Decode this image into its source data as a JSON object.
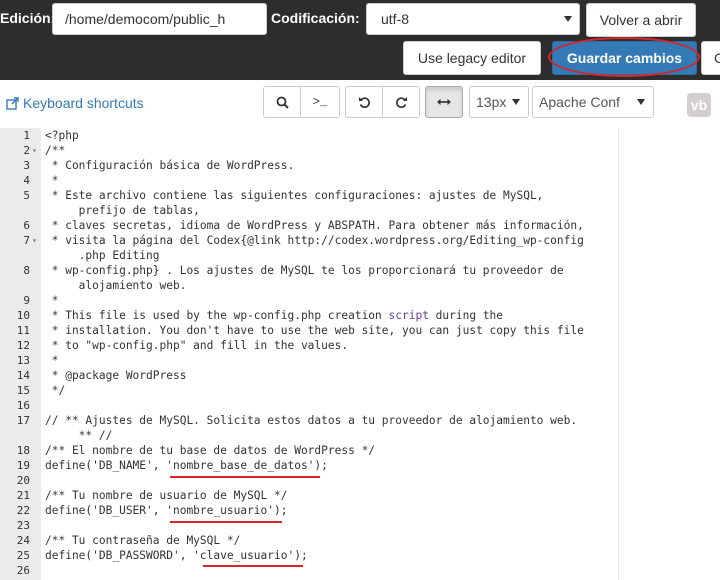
{
  "topbar": {
    "path_label": "Edición:",
    "path_value": "/home/democom/public_h",
    "encoding_label": "Codificación:",
    "encoding_value": "utf-8",
    "reopen_button": "Volver a abrir",
    "legacy_button": "Use legacy editor",
    "save_button": "Guardar cambios",
    "close_button": "C"
  },
  "toolbar": {
    "keyboard_shortcuts": "Keyboard shortcuts",
    "terminal_glyph": ">_",
    "font_size": "13px",
    "mode": "Apache Conf",
    "logo": "vb"
  },
  "editor": {
    "lines": [
      {
        "n": "1",
        "fold": "",
        "segs": [
          {
            "t": "<?php",
            "k": "c"
          }
        ]
      },
      {
        "n": "2",
        "fold": "▾",
        "segs": [
          {
            "t": "/**",
            "k": "c"
          }
        ]
      },
      {
        "n": "3",
        "fold": "",
        "segs": [
          {
            "t": " * Configuración básica de WordPress.",
            "k": "c"
          }
        ]
      },
      {
        "n": "4",
        "fold": "",
        "segs": [
          {
            "t": " *",
            "k": "c"
          }
        ]
      },
      {
        "n": "5",
        "fold": "",
        "segs": [
          {
            "t": " * Este archivo contiene las siguientes configuraciones: ajustes de MySQL,",
            "k": "c"
          }
        ]
      },
      {
        "n": "",
        "fold": "",
        "segs": [
          {
            "t": "     prefijo de tablas,",
            "k": "c"
          }
        ]
      },
      {
        "n": "6",
        "fold": "",
        "segs": [
          {
            "t": " * claves secretas, idioma de WordPress y ABSPATH. Para obtener más información,",
            "k": "c"
          }
        ]
      },
      {
        "n": "7",
        "fold": "▾",
        "segs": [
          {
            "t": " * visita la página del Codex{@link http://codex.wordpress.org/Editing_wp-config",
            "k": "c"
          }
        ]
      },
      {
        "n": "",
        "fold": "",
        "segs": [
          {
            "t": "     .php Editing",
            "k": "c"
          }
        ]
      },
      {
        "n": "8",
        "fold": "",
        "segs": [
          {
            "t": " * wp-config.php} . Los ajustes de MySQL te los proporcionará tu proveedor de",
            "k": "c"
          }
        ]
      },
      {
        "n": "",
        "fold": "",
        "segs": [
          {
            "t": "     alojamiento web.",
            "k": "c"
          }
        ]
      },
      {
        "n": "9",
        "fold": "",
        "segs": [
          {
            "t": " *",
            "k": "c"
          }
        ]
      },
      {
        "n": "10",
        "fold": "",
        "segs": [
          {
            "t": " * This file is used by the wp-config.php creation ",
            "k": "c"
          },
          {
            "t": "script",
            "k": "kw"
          },
          {
            "t": " during the",
            "k": "c"
          }
        ]
      },
      {
        "n": "11",
        "fold": "",
        "segs": [
          {
            "t": " * installation. You don't have to use the web site, you can just copy this file",
            "k": "c"
          }
        ]
      },
      {
        "n": "12",
        "fold": "",
        "segs": [
          {
            "t": " * to \"wp-config.php\" and fill in the values.",
            "k": "c"
          }
        ]
      },
      {
        "n": "13",
        "fold": "",
        "segs": [
          {
            "t": " *",
            "k": "c"
          }
        ]
      },
      {
        "n": "14",
        "fold": "",
        "segs": [
          {
            "t": " * @package WordPress",
            "k": "c"
          }
        ]
      },
      {
        "n": "15",
        "fold": "",
        "segs": [
          {
            "t": " */",
            "k": "c"
          }
        ]
      },
      {
        "n": "16",
        "fold": "",
        "segs": [
          {
            "t": "",
            "k": "c"
          }
        ]
      },
      {
        "n": "17",
        "fold": "",
        "segs": [
          {
            "t": "// ** Ajustes de MySQL. Solicita estos datos a tu proveedor de alojamiento web.",
            "k": "c"
          }
        ]
      },
      {
        "n": "",
        "fold": "",
        "segs": [
          {
            "t": "     ** //",
            "k": "c"
          }
        ]
      },
      {
        "n": "18",
        "fold": "",
        "segs": [
          {
            "t": "/** El nombre de tu base de datos de WordPress */",
            "k": "c"
          }
        ]
      },
      {
        "n": "19",
        "fold": "",
        "segs": [
          {
            "t": "define('DB_NAME', 'nombre_base_de_datos');",
            "k": "c"
          }
        ]
      },
      {
        "n": "20",
        "fold": "",
        "segs": [
          {
            "t": "",
            "k": "c"
          }
        ]
      },
      {
        "n": "21",
        "fold": "",
        "segs": [
          {
            "t": "/** Tu nombre de usuario de MySQL */",
            "k": "c"
          }
        ]
      },
      {
        "n": "22",
        "fold": "",
        "segs": [
          {
            "t": "define('DB_USER', 'nombre_usuario');",
            "k": "c"
          }
        ]
      },
      {
        "n": "23",
        "fold": "",
        "segs": [
          {
            "t": "",
            "k": "c"
          }
        ]
      },
      {
        "n": "24",
        "fold": "",
        "segs": [
          {
            "t": "/** Tu contraseña de MySQL */",
            "k": "c"
          }
        ]
      },
      {
        "n": "25",
        "fold": "",
        "segs": [
          {
            "t": "define('DB_PASSWORD', 'clave_usuario');",
            "k": "c"
          }
        ]
      },
      {
        "n": "26",
        "fold": "",
        "segs": [
          {
            "t": "",
            "k": "c"
          }
        ]
      }
    ]
  },
  "colors": {
    "accent": "#337ab7",
    "highlight_ring": "#d9252a",
    "topbar": "#2d2d2d",
    "keyword": "#6a3e9c"
  },
  "icons": [
    "search-icon",
    "terminal-icon",
    "undo-icon",
    "redo-icon",
    "wrap-icon",
    "external-link-icon"
  ]
}
